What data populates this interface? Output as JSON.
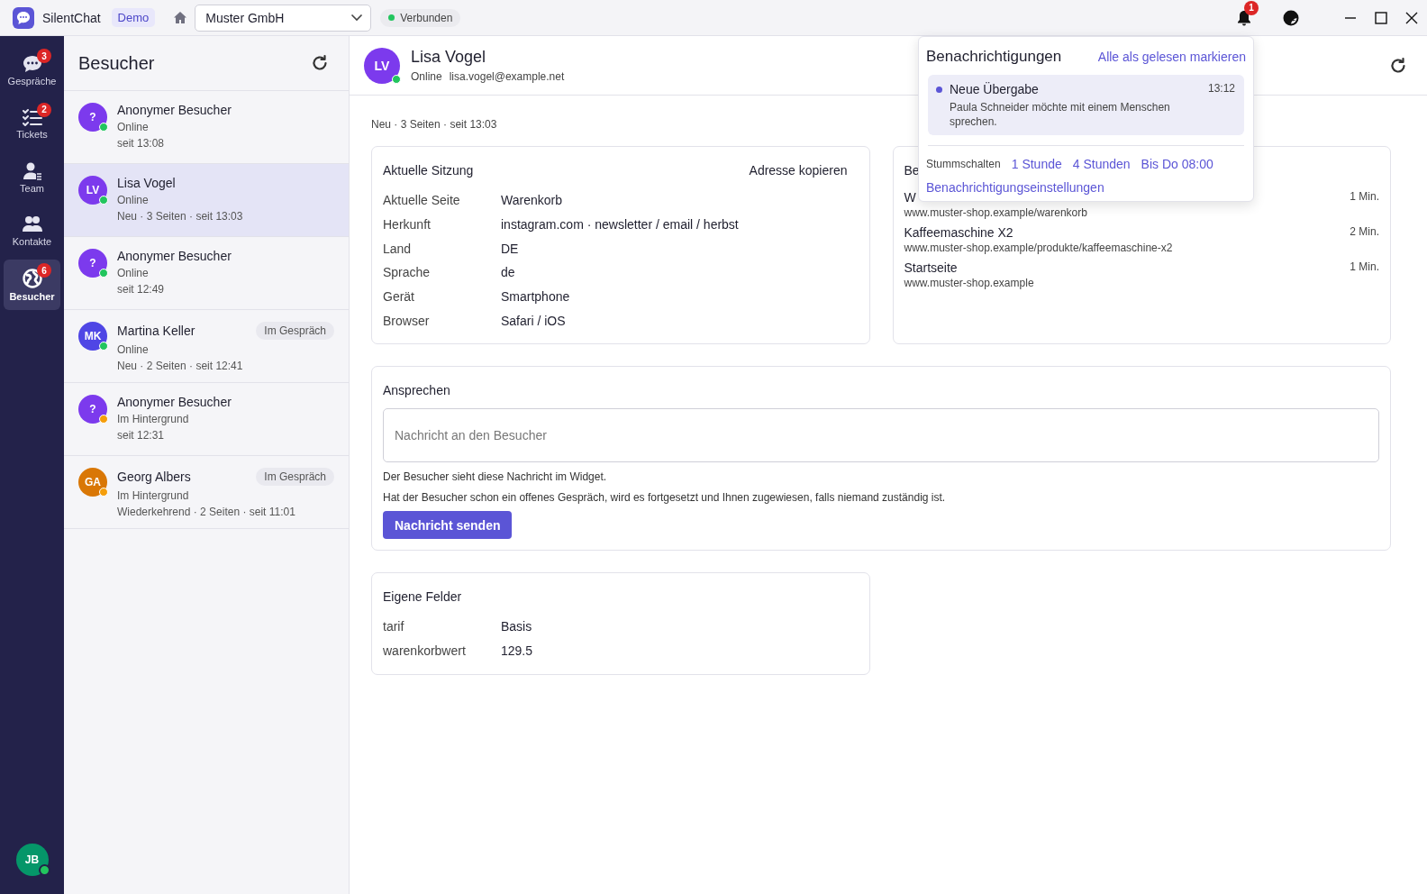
{
  "app": {
    "name": "SilentChat",
    "badge": "Demo"
  },
  "workspace": {
    "value": "Muster GmbH"
  },
  "connection": {
    "label": "Verbunden",
    "connected": true
  },
  "notification_badge": "1",
  "nav": [
    {
      "kind": "chat",
      "label": "Gespräche",
      "count": "3",
      "selected": false
    },
    {
      "kind": "tickets",
      "label": "Tickets",
      "count": "2",
      "selected": false
    },
    {
      "kind": "team",
      "label": "Team",
      "selected": false
    },
    {
      "kind": "contacts",
      "label": "Kontakte",
      "selected": false
    },
    {
      "kind": "visitors",
      "label": "Besucher",
      "count": "6",
      "selected": true
    }
  ],
  "user": {
    "initials": "JB",
    "online": true
  },
  "visitors": {
    "title": "Besucher",
    "items": [
      {
        "avatar": {
          "initials": "?",
          "color": "#7c3aed"
        },
        "name": "Anonymer Besucher",
        "status": "Online",
        "color": "#22c55e",
        "meta": "seit 13:08",
        "selected": false
      },
      {
        "avatar": {
          "initials": "LV",
          "color": "#7c3aed"
        },
        "name": "Lisa Vogel",
        "status": "Online",
        "color": "#22c55e",
        "meta": "Neu · 3 Seiten · seit 13:03",
        "selected": true
      },
      {
        "avatar": {
          "initials": "?",
          "color": "#7c3aed"
        },
        "name": "Anonymer Besucher",
        "status": "Online",
        "color": "#22c55e",
        "meta": "seit 12:49",
        "selected": false
      },
      {
        "avatar": {
          "initials": "MK",
          "color": "#4f46e5"
        },
        "name": "Martina Keller",
        "status": "Online",
        "color": "#22c55e",
        "meta": "Neu · 2 Seiten · seit 12:41",
        "tag": "Im Gespräch",
        "selected": false
      },
      {
        "avatar": {
          "initials": "?",
          "color": "#7c3aed"
        },
        "name": "Anonymer Besucher",
        "status": "Im Hintergrund",
        "color": "#f59e0b",
        "meta": "seit 12:31",
        "selected": false
      },
      {
        "avatar": {
          "initials": "GA",
          "color": "#d97706"
        },
        "name": "Georg Albers",
        "status": "Im Hintergrund",
        "color": "#f59e0b",
        "meta": "Wiederkehrend · 2 Seiten · seit 11:01",
        "tag": "Im Gespräch",
        "selected": false
      }
    ]
  },
  "detail": {
    "avatar": {
      "initials": "LV",
      "color": "#7c3aed"
    },
    "name": "Lisa Vogel",
    "status": "Online",
    "color": "#22c55e",
    "email": "lisa.vogel@example.net",
    "summary": "Neu · 3 Seiten · seit 13:03",
    "session": {
      "title": "Aktuelle Sitzung",
      "action": "Adresse kopieren",
      "rows": [
        {
          "label": "Aktuelle Seite",
          "value": "Warenkorb"
        },
        {
          "label": "Herkunft",
          "value": "instagram.com · newsletter / email / herbst"
        },
        {
          "label": "Land",
          "value": "DE"
        },
        {
          "label": "Sprache",
          "value": "de"
        },
        {
          "label": "Gerät",
          "value": "Smartphone"
        },
        {
          "label": "Browser",
          "value": "Safari / iOS"
        }
      ]
    },
    "pages": {
      "title": "Be",
      "items": [
        {
          "title": "W",
          "url": "www.muster-shop.example/warenkorb",
          "duration": "1 Min."
        },
        {
          "title": "Kaffeemaschine X2",
          "url": "www.muster-shop.example/produkte/kaffeemaschine-x2",
          "duration": "2 Min."
        },
        {
          "title": "Startseite",
          "url": "www.muster-shop.example",
          "duration": "1 Min."
        }
      ]
    },
    "contact": {
      "title": "Ansprechen",
      "placeholder": "Nachricht an den Besucher",
      "notes": [
        "Der Besucher sieht diese Nachricht im Widget.",
        "Hat der Besucher schon ein offenes Gespräch, wird es fortgesetzt und Ihnen zugewiesen, falls niemand zuständig ist."
      ],
      "button": "Nachricht senden"
    },
    "fields": {
      "title": "Eigene Felder",
      "rows": [
        {
          "label": "tarif",
          "value": "Basis"
        },
        {
          "label": "warenkorbwert",
          "value": "129.5"
        }
      ]
    }
  },
  "popup": {
    "title": "Benachrichtigungen",
    "action": "Alle als gelesen markieren",
    "items": [
      {
        "title": "Neue Übergabe",
        "time": "13:12",
        "text": "Paula Schneider möchte mit einem Menschen sprechen.",
        "unread": true
      }
    ],
    "mute_label": "Stummschalten",
    "mute_options": [
      "1 Stunde",
      "4 Stunden",
      "Bis Do 08:00"
    ],
    "settings_link": "Benachrichtigungseinstellungen"
  }
}
